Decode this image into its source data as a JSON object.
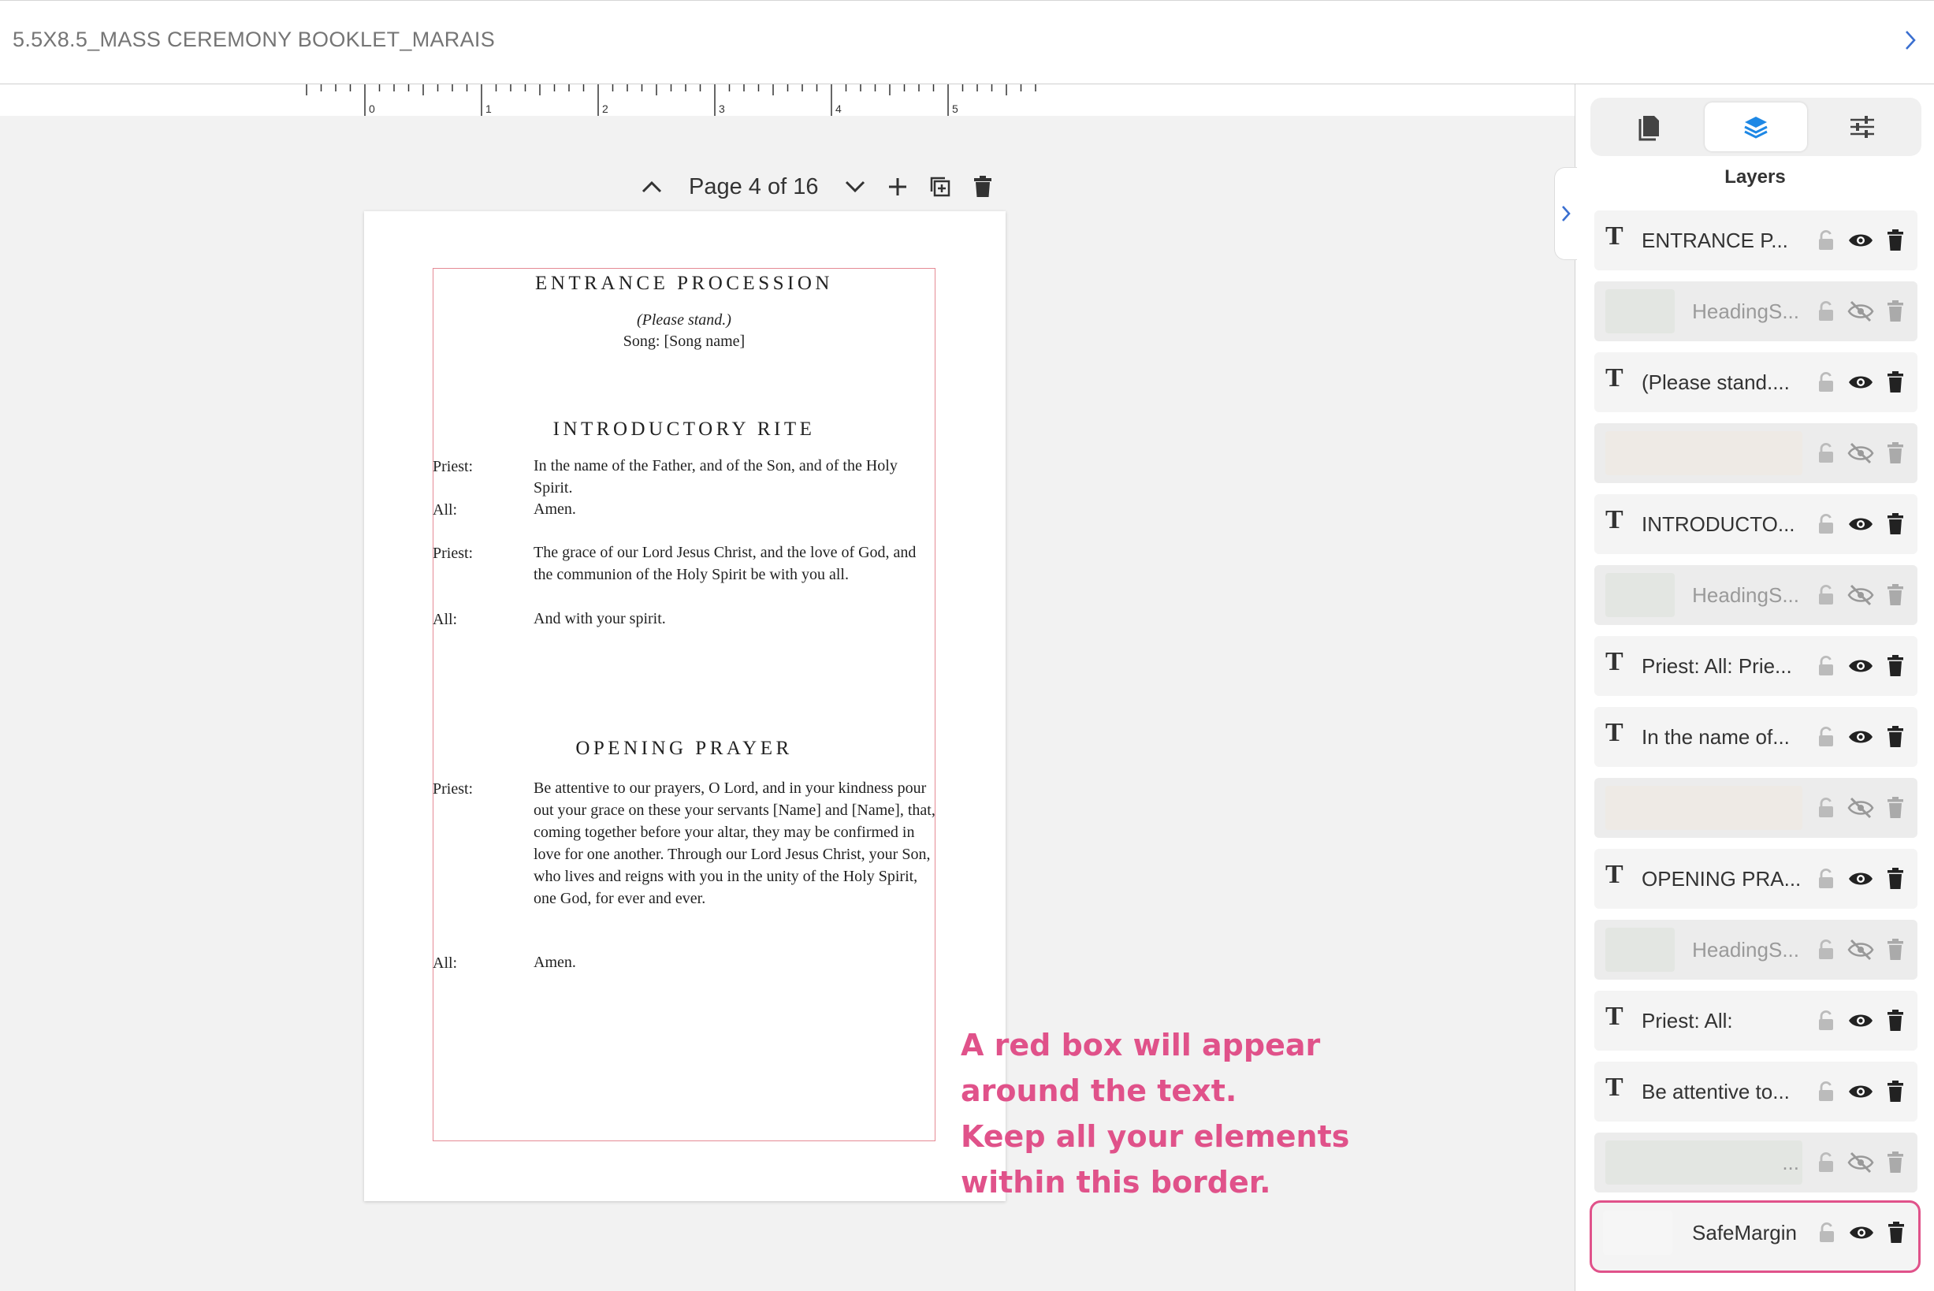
{
  "header": {
    "doc_title": "5.5X8.5_MASS CEREMONY BOOKLET_MARAIS"
  },
  "ruler": {
    "labels": [
      "0",
      "1",
      "2",
      "3",
      "4",
      "5"
    ]
  },
  "pager": {
    "label": "Page 4 of 16"
  },
  "page": {
    "entrance_heading": "ENTRANCE PROCESSION",
    "please_stand": "(Please stand.)",
    "song": "Song: [Song name]",
    "intro_heading": "INTRODUCTORY RITE",
    "intro_lines": [
      {
        "role": "Priest:",
        "text": "In the name of the Father, and of the Son, and of the Holy Spirit."
      },
      {
        "role": "All:",
        "text": "Amen."
      },
      {
        "role": "Priest:",
        "text": "The grace of our Lord Jesus Christ, and the love of God, and the communion of the Holy Spirit be with you all."
      },
      {
        "role": "All:",
        "text": "And with your spirit."
      }
    ],
    "opening_heading": "OPENING PRAYER",
    "opening_lines": [
      {
        "role": "Priest:",
        "text": "Be attentive to our prayers, O Lord, and in your kindness pour out your grace on these your servants [Name] and [Name], that, coming together before your altar, they may be confirmed in love for one another. Through our Lord Jesus Christ, your Son, who lives and reigns with you in the unity of the Holy Spirit, one God, for ever and ever."
      },
      {
        "role": "All:",
        "text": "Amen."
      }
    ]
  },
  "hint": {
    "line1": "A red box will appear",
    "line2": "around the text.",
    "line3": "Keep all your elements",
    "line4": "within this border."
  },
  "panel": {
    "title": "Layers",
    "tabs": [
      "pages-icon",
      "layers-icon",
      "settings-sliders-icon"
    ],
    "layers": [
      {
        "name": "ENTRANCE P...",
        "kind": "text",
        "visible": true
      },
      {
        "name": "HeadingS...",
        "kind": "image",
        "visible": false
      },
      {
        "name": "(Please stand....",
        "kind": "text",
        "visible": true
      },
      {
        "name": "",
        "kind": "image-wide",
        "visible": false
      },
      {
        "name": "INTRODUCTO...",
        "kind": "text",
        "visible": true
      },
      {
        "name": "HeadingS...",
        "kind": "image",
        "visible": false
      },
      {
        "name": "Priest: All: Prie...",
        "kind": "text",
        "visible": true
      },
      {
        "name": "In the name of...",
        "kind": "text",
        "visible": true
      },
      {
        "name": "",
        "kind": "image-wide",
        "visible": false
      },
      {
        "name": "OPENING PRA...",
        "kind": "text",
        "visible": true
      },
      {
        "name": "HeadingS...",
        "kind": "image",
        "visible": false
      },
      {
        "name": "Priest: All:",
        "kind": "text",
        "visible": true
      },
      {
        "name": "Be attentive to...",
        "kind": "text",
        "visible": true
      },
      {
        "name": "...",
        "kind": "image-wide",
        "visible": false
      },
      {
        "name": "SafeMargin",
        "kind": "image-selected",
        "visible": true
      }
    ]
  },
  "colors": {
    "accent": "#e0528a",
    "safe_border": "#e58a95",
    "active_tab_icon": "#1e88e5"
  }
}
